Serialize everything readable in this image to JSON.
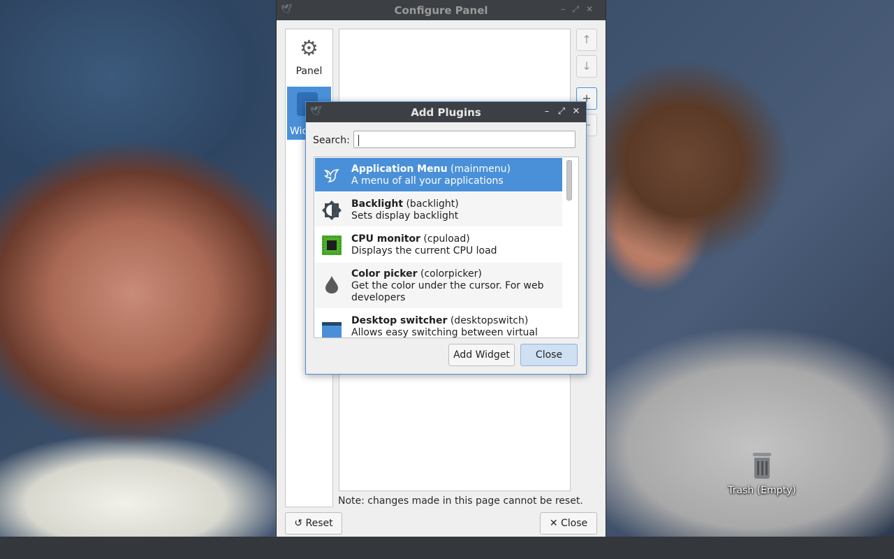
{
  "configure_window": {
    "title": "Configure Panel",
    "sidebar": [
      {
        "label": "Panel",
        "icon": "gear-icon"
      },
      {
        "label": "Widgets",
        "icon": "puzzle-icon"
      }
    ],
    "move_up_icon": "↑",
    "move_down_icon": "↓",
    "add_icon": "+",
    "remove_icon": "−",
    "note": "Note: changes made in this page cannot be reset.",
    "reset_label": "↺ Reset",
    "close_label": "✕ Close"
  },
  "add_plugins_dialog": {
    "title": "Add Plugins",
    "minimize_glyph": "–",
    "maximize_glyph": "⤢",
    "close_glyph": "✕",
    "search_label": "Search:",
    "search_value": "",
    "plugins": [
      {
        "name": "Application Menu",
        "id": "(mainmenu)",
        "desc": "A menu of all your applications",
        "icon": "bird-icon",
        "selected": true
      },
      {
        "name": "Backlight",
        "id": "(backlight)",
        "desc": "Sets display backlight",
        "icon": "brightness-icon"
      },
      {
        "name": "CPU monitor",
        "id": "(cpuload)",
        "desc": "Displays the current CPU load",
        "icon": "cpu-chip-icon"
      },
      {
        "name": "Color picker",
        "id": "(colorpicker)",
        "desc": "Get the color under the cursor. For web developers",
        "icon": "droplet-icon"
      },
      {
        "name": "Desktop switcher",
        "id": "(desktopswitch)",
        "desc": "Allows easy switching between virtual",
        "icon": "window-icon"
      }
    ],
    "add_widget_label": "Add Widget",
    "close_label": "Close"
  },
  "desktop": {
    "trash_label": "Trash (Empty)"
  },
  "colors": {
    "selection": "#4a90d9",
    "titlebar": "#3c3f43",
    "taskbar": "#34373b"
  }
}
